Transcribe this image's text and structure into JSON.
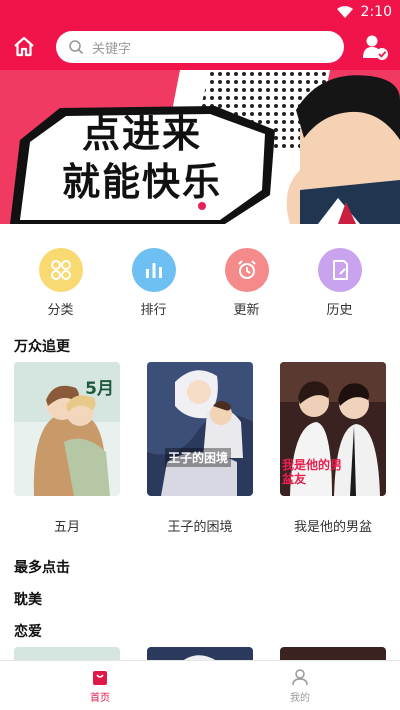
{
  "status_bar": {
    "time": "2:10"
  },
  "header": {
    "search_placeholder": "关键字"
  },
  "banner": {
    "line1": "点进来",
    "line2": "就能快乐"
  },
  "quick_links": [
    {
      "label": "分类",
      "color": "#f9d972",
      "icon": "grid-icon"
    },
    {
      "label": "排行",
      "color": "#6fc0f2",
      "icon": "bar-chart-icon"
    },
    {
      "label": "更新",
      "color": "#f58a8a",
      "icon": "alarm-clock-icon"
    },
    {
      "label": "历史",
      "color": "#c9a3ee",
      "icon": "history-note-icon"
    }
  ],
  "sections": {
    "popular": {
      "title": "万众追更",
      "books": [
        {
          "title": "五月",
          "cover_text": "5月"
        },
        {
          "title": "王子的困境",
          "cover_text": "王子的困境"
        },
        {
          "title": "我是他的男盆",
          "cover_text": "我是他的男盆友"
        }
      ]
    },
    "most_clicked": {
      "title": "最多点击"
    },
    "genre_bl": {
      "title": "耽美"
    },
    "genre_romance": {
      "title": "恋爱"
    }
  },
  "bottom_nav": [
    {
      "label": "首页",
      "active": true,
      "icon": "home-bag-icon"
    },
    {
      "label": "我的",
      "active": false,
      "icon": "person-icon"
    }
  ],
  "colors": {
    "brand": "#f0144a",
    "active_tab": "#e0184a"
  }
}
